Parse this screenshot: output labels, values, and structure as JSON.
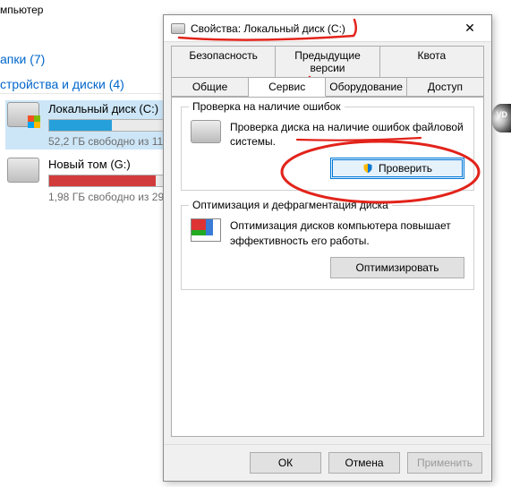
{
  "explorer": {
    "top_partial": "мпьютер",
    "folders_label": "апки (7)",
    "devices_label": "стройства и диски (4)",
    "drives": [
      {
        "name": "Локальный диск (C:)",
        "sub": "52,2 ГБ свободно из 11",
        "fill_color": "#26a0da",
        "fill_pct": 55
      },
      {
        "name": "Новый том (G:)",
        "sub": "1,98 ГБ свободно из 29",
        "fill_color": "#d23b3b",
        "fill_pct": 93
      }
    ],
    "dvd_label": "VD"
  },
  "dialog": {
    "title": "Свойства: Локальный диск (C:)",
    "tabs_row1": [
      {
        "label": "Безопасность"
      },
      {
        "label": "Предыдущие версии"
      },
      {
        "label": "Квота"
      }
    ],
    "tabs_row2": [
      {
        "label": "Общие"
      },
      {
        "label": "Сервис",
        "active": true
      },
      {
        "label": "Оборудование"
      },
      {
        "label": "Доступ"
      }
    ],
    "error_check": {
      "legend": "Проверка на наличие ошибок",
      "text": "Проверка диска на наличие ошибок файловой системы.",
      "button": "Проверить"
    },
    "defrag": {
      "legend": "Оптимизация и дефрагментация диска",
      "text": "Оптимизация дисков компьютера повышает эффективность его работы.",
      "button": "Оптимизировать"
    },
    "buttons": {
      "ok": "ОК",
      "cancel": "Отмена",
      "apply": "Применить"
    }
  }
}
